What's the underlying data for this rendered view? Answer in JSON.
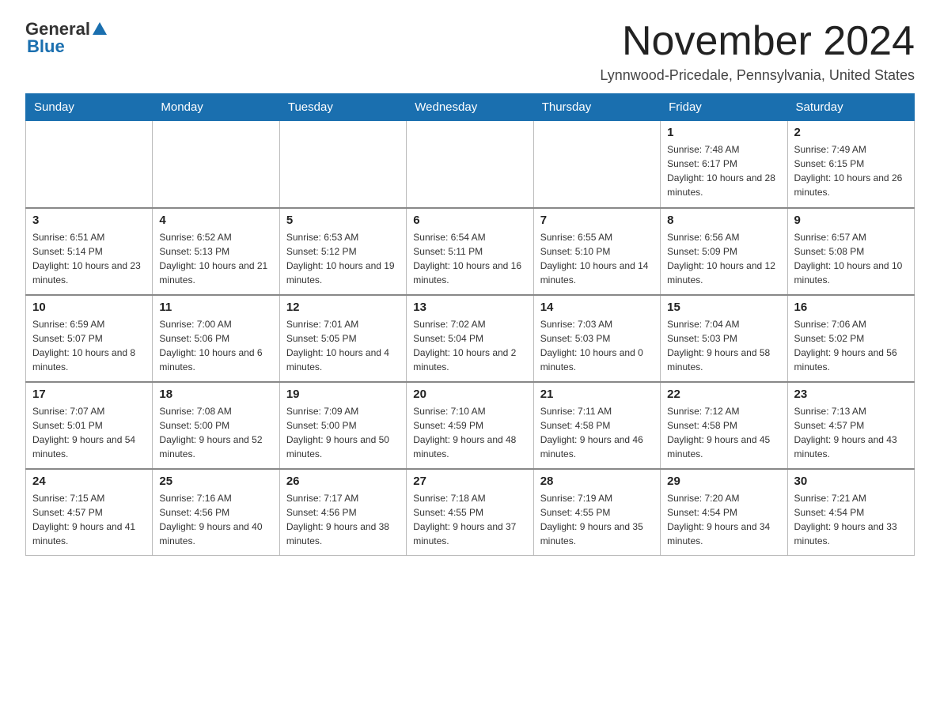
{
  "logo": {
    "general": "General",
    "blue": "Blue"
  },
  "title": {
    "month_year": "November 2024",
    "location": "Lynnwood-Pricedale, Pennsylvania, United States"
  },
  "weekdays": [
    "Sunday",
    "Monday",
    "Tuesday",
    "Wednesday",
    "Thursday",
    "Friday",
    "Saturday"
  ],
  "weeks": [
    [
      {
        "day": "",
        "info": ""
      },
      {
        "day": "",
        "info": ""
      },
      {
        "day": "",
        "info": ""
      },
      {
        "day": "",
        "info": ""
      },
      {
        "day": "",
        "info": ""
      },
      {
        "day": "1",
        "info": "Sunrise: 7:48 AM\nSunset: 6:17 PM\nDaylight: 10 hours and 28 minutes."
      },
      {
        "day": "2",
        "info": "Sunrise: 7:49 AM\nSunset: 6:15 PM\nDaylight: 10 hours and 26 minutes."
      }
    ],
    [
      {
        "day": "3",
        "info": "Sunrise: 6:51 AM\nSunset: 5:14 PM\nDaylight: 10 hours and 23 minutes."
      },
      {
        "day": "4",
        "info": "Sunrise: 6:52 AM\nSunset: 5:13 PM\nDaylight: 10 hours and 21 minutes."
      },
      {
        "day": "5",
        "info": "Sunrise: 6:53 AM\nSunset: 5:12 PM\nDaylight: 10 hours and 19 minutes."
      },
      {
        "day": "6",
        "info": "Sunrise: 6:54 AM\nSunset: 5:11 PM\nDaylight: 10 hours and 16 minutes."
      },
      {
        "day": "7",
        "info": "Sunrise: 6:55 AM\nSunset: 5:10 PM\nDaylight: 10 hours and 14 minutes."
      },
      {
        "day": "8",
        "info": "Sunrise: 6:56 AM\nSunset: 5:09 PM\nDaylight: 10 hours and 12 minutes."
      },
      {
        "day": "9",
        "info": "Sunrise: 6:57 AM\nSunset: 5:08 PM\nDaylight: 10 hours and 10 minutes."
      }
    ],
    [
      {
        "day": "10",
        "info": "Sunrise: 6:59 AM\nSunset: 5:07 PM\nDaylight: 10 hours and 8 minutes."
      },
      {
        "day": "11",
        "info": "Sunrise: 7:00 AM\nSunset: 5:06 PM\nDaylight: 10 hours and 6 minutes."
      },
      {
        "day": "12",
        "info": "Sunrise: 7:01 AM\nSunset: 5:05 PM\nDaylight: 10 hours and 4 minutes."
      },
      {
        "day": "13",
        "info": "Sunrise: 7:02 AM\nSunset: 5:04 PM\nDaylight: 10 hours and 2 minutes."
      },
      {
        "day": "14",
        "info": "Sunrise: 7:03 AM\nSunset: 5:03 PM\nDaylight: 10 hours and 0 minutes."
      },
      {
        "day": "15",
        "info": "Sunrise: 7:04 AM\nSunset: 5:03 PM\nDaylight: 9 hours and 58 minutes."
      },
      {
        "day": "16",
        "info": "Sunrise: 7:06 AM\nSunset: 5:02 PM\nDaylight: 9 hours and 56 minutes."
      }
    ],
    [
      {
        "day": "17",
        "info": "Sunrise: 7:07 AM\nSunset: 5:01 PM\nDaylight: 9 hours and 54 minutes."
      },
      {
        "day": "18",
        "info": "Sunrise: 7:08 AM\nSunset: 5:00 PM\nDaylight: 9 hours and 52 minutes."
      },
      {
        "day": "19",
        "info": "Sunrise: 7:09 AM\nSunset: 5:00 PM\nDaylight: 9 hours and 50 minutes."
      },
      {
        "day": "20",
        "info": "Sunrise: 7:10 AM\nSunset: 4:59 PM\nDaylight: 9 hours and 48 minutes."
      },
      {
        "day": "21",
        "info": "Sunrise: 7:11 AM\nSunset: 4:58 PM\nDaylight: 9 hours and 46 minutes."
      },
      {
        "day": "22",
        "info": "Sunrise: 7:12 AM\nSunset: 4:58 PM\nDaylight: 9 hours and 45 minutes."
      },
      {
        "day": "23",
        "info": "Sunrise: 7:13 AM\nSunset: 4:57 PM\nDaylight: 9 hours and 43 minutes."
      }
    ],
    [
      {
        "day": "24",
        "info": "Sunrise: 7:15 AM\nSunset: 4:57 PM\nDaylight: 9 hours and 41 minutes."
      },
      {
        "day": "25",
        "info": "Sunrise: 7:16 AM\nSunset: 4:56 PM\nDaylight: 9 hours and 40 minutes."
      },
      {
        "day": "26",
        "info": "Sunrise: 7:17 AM\nSunset: 4:56 PM\nDaylight: 9 hours and 38 minutes."
      },
      {
        "day": "27",
        "info": "Sunrise: 7:18 AM\nSunset: 4:55 PM\nDaylight: 9 hours and 37 minutes."
      },
      {
        "day": "28",
        "info": "Sunrise: 7:19 AM\nSunset: 4:55 PM\nDaylight: 9 hours and 35 minutes."
      },
      {
        "day": "29",
        "info": "Sunrise: 7:20 AM\nSunset: 4:54 PM\nDaylight: 9 hours and 34 minutes."
      },
      {
        "day": "30",
        "info": "Sunrise: 7:21 AM\nSunset: 4:54 PM\nDaylight: 9 hours and 33 minutes."
      }
    ]
  ]
}
